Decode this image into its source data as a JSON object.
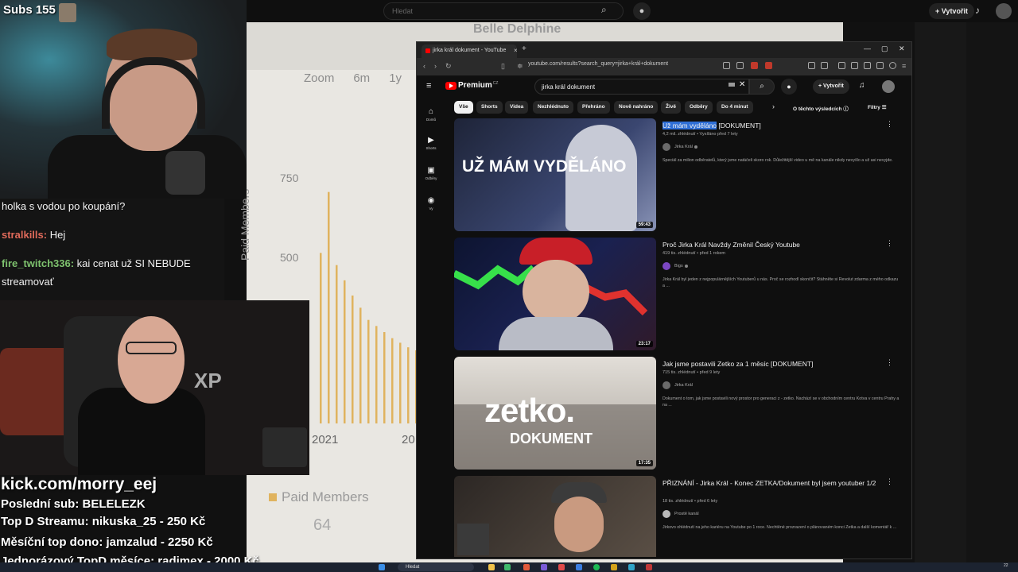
{
  "stream": {
    "subs_label": "Subs 155",
    "chat": [
      {
        "user": "",
        "text": "holka s vodou po koupání?"
      },
      {
        "user": "stralkills:",
        "text": "Hej",
        "color": "#e06a5a"
      },
      {
        "user": "fire_twitch336:",
        "text": "kai cenat už SI NEBUDE",
        "color": "#7ec26e"
      },
      {
        "user": "",
        "text": "streamovať"
      }
    ],
    "overlay": {
      "url": "kick.com/morry_eej",
      "last_sub": "Poslední sub: BELELEZK",
      "top_stream": "Top D Streamu: nikuska_25 - 250 Kč",
      "monthly_top": "Měsíční top dono: jamzalud - 2250 Kč",
      "one_time_top": "Jednorázový TopD měsíce: radimex - 2000 Kč"
    }
  },
  "background_youtube": {
    "search_placeholder": "Hledat",
    "create_label": "Vytvořit",
    "chart_blur_title": "Belle Delphine"
  },
  "chart_data": {
    "type": "bar",
    "xlabel": "",
    "ylabel": "Paid Members",
    "yticks": [
      750,
      500
    ],
    "xticks": [
      "2021",
      "20"
    ],
    "zoom_options": [
      "Zoom",
      "6m",
      "1y"
    ],
    "legend": "Paid Members",
    "legend_value": "64",
    "ylim": [
      0,
      900
    ],
    "values": [
      560,
      760,
      520,
      470,
      420,
      380,
      340,
      320,
      300,
      280,
      265,
      250,
      240,
      230
    ],
    "color": "#e0b35e"
  },
  "browser": {
    "tab_title": "jirka král dokument - YouTube",
    "url": "youtube.com/results?search_query=jirka+král+dokument"
  },
  "youtube": {
    "logo_text": "Premium",
    "logo_region": "CZ",
    "search_value": "jirka král dokument",
    "create_label": "Vytvořit",
    "sidebar": [
      {
        "icon": "home-icon",
        "glyph": "⌂",
        "label": "Domů"
      },
      {
        "icon": "shorts-icon",
        "glyph": "▶",
        "label": "Shorts"
      },
      {
        "icon": "subscriptions-icon",
        "glyph": "▣",
        "label": "Odběry"
      },
      {
        "icon": "you-icon",
        "glyph": "◉",
        "label": "Vy"
      }
    ],
    "chips": [
      "Vše",
      "Shorts",
      "Videa",
      "Nezhlédnuto",
      "Přehráno",
      "Nově nahráno",
      "Živě",
      "Odběry",
      "Do 4 minut"
    ],
    "about_results": "O těchto výsledcích",
    "filters_label": "Filtry",
    "results": [
      {
        "title_highlight": "Už mám vyděláno",
        "title_rest": " [DOKUMENT]",
        "meta": "4,2 mil. zhlédnutí • Vysíláno před 7 lety",
        "channel": "Jirka Král",
        "desc": "Speciál za milion odběratelů, který jsme natáčeli skoro rok. Důležitější video u mě na kanále nikdy nevyšlo a už asi nevyjde.",
        "duration": "59:43",
        "thumb_text": "UŽ MÁM VYDĚLÁNO",
        "thumb_colors": [
          "#2a2f45",
          "#7d8bb0"
        ]
      },
      {
        "title_highlight": "",
        "title_rest": "Proč Jirka Král Navždy Změnil Český Youtube",
        "meta": "419 tis. zhlédnutí • před 1 rokem",
        "channel": "Bigs",
        "desc": "Jirka Král byl jeden z nejpopulárnějších Youtuberů u nás. Proč se rozhodl skončit? Stáhněte si Revolut zdarma z mého odkazu a ...",
        "duration": "23:17",
        "thumb_text": "",
        "thumb_colors": [
          "#111a3a",
          "#2a1e3a"
        ]
      },
      {
        "title_highlight": "",
        "title_rest": "Jak jsme postavili Zetko za 1 měsíc [DOKUMENT]",
        "meta": "715 tis. zhlédnutí • před 9 lety",
        "channel": "Jirka Král",
        "desc": "Dokument o tom, jak jsme postavili nový prostor pro generaci z - zetko. Nachází se v obchodním centru Kotva v centru Prahy a na ...",
        "duration": "17:35",
        "thumb_text": "zetko.",
        "thumb_sub": "DOKUMENT",
        "thumb_colors": [
          "#c9c4bd",
          "#8a857f"
        ]
      },
      {
        "title_highlight": "",
        "title_rest": "PŘIZNÁNÍ - Jirka Král - Konec ZETKA/Dokument byl jsem youtuber 1/2",
        "meta": "18 tis. zhlédnutí • před 6 lety",
        "channel": "Prostě kanál",
        "desc": "Jirkovo ohlédnutí na jeho kariéru na Youtube po 1 roce. Nechtěné prozrazení o plánovaném konci Zetka a další komentář k ...",
        "duration": "",
        "thumb_text": "",
        "thumb_colors": [
          "#3a3430",
          "#6a5e52"
        ]
      }
    ]
  },
  "taskbar": {
    "search_placeholder": "Hledat",
    "time": "22"
  }
}
